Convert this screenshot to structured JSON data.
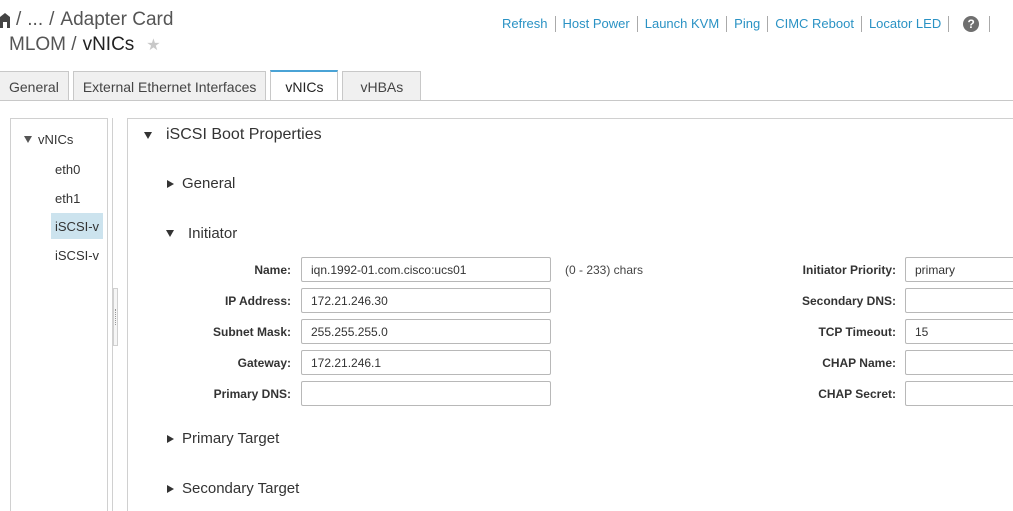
{
  "header": {
    "breadcrumb_ellipsis": "...",
    "breadcrumb_last": "Adapter Card",
    "title_prefix": "MLOM /",
    "title_main": "vNICs",
    "star": "★",
    "actions": [
      "Refresh",
      "Host Power",
      "Launch KVM",
      "Ping",
      "CIMC Reboot",
      "Locator LED"
    ],
    "help": "?"
  },
  "tabs": [
    {
      "label": "General",
      "active": false
    },
    {
      "label": "External Ethernet Interfaces",
      "active": false
    },
    {
      "label": "vNICs",
      "active": true
    },
    {
      "label": "vHBAs",
      "active": false
    }
  ],
  "tree": {
    "root": "vNICs",
    "items": [
      {
        "label": "eth0",
        "selected": false
      },
      {
        "label": "eth1",
        "selected": false
      },
      {
        "label": "iSCSI-v",
        "selected": true
      },
      {
        "label": "iSCSI-v",
        "selected": false
      }
    ]
  },
  "panel": {
    "title": "iSCSI Boot Properties",
    "sections": {
      "general": "General",
      "initiator": "Initiator",
      "primary_target": "Primary Target",
      "secondary_target": "Secondary Target"
    },
    "initiator": {
      "name_label": "Name:",
      "name_value": "iqn.1992-01.com.cisco:ucs01",
      "name_hint": "(0 - 233) chars",
      "ip_label": "IP Address:",
      "ip_value": "172.21.246.30",
      "subnet_label": "Subnet Mask:",
      "subnet_value": "255.255.255.0",
      "gateway_label": "Gateway:",
      "gateway_value": "172.21.246.1",
      "pdns_label": "Primary DNS:",
      "pdns_value": "",
      "priority_label": "Initiator Priority:",
      "priority_value": "primary",
      "sdns_label": "Secondary DNS:",
      "sdns_value": "",
      "tcp_label": "TCP Timeout:",
      "tcp_value": "15",
      "chap_name_label": "CHAP Name:",
      "chap_name_value": "",
      "chap_secret_label": "CHAP Secret:",
      "chap_secret_value": ""
    }
  },
  "colors": {
    "link": "#2a92c4",
    "tab_accent": "#4aa3d6",
    "tree_selected": "#cce3ee"
  }
}
